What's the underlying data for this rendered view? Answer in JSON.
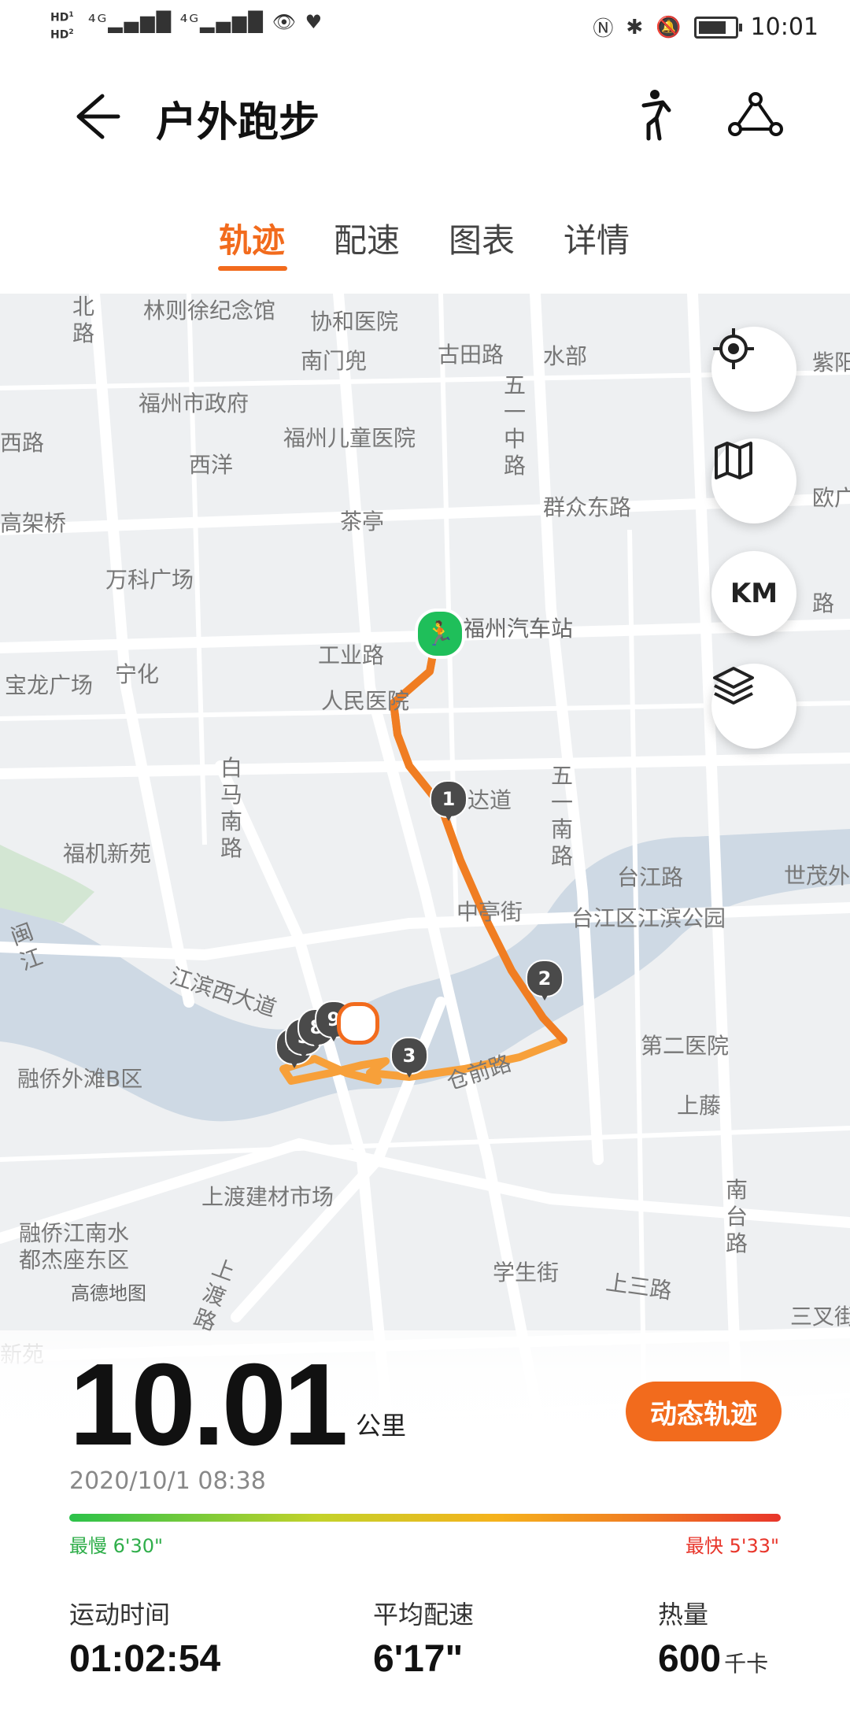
{
  "status_bar": {
    "left_indicators": "HD HD 4G 4G",
    "time": "10:01"
  },
  "header": {
    "title": "户外跑步",
    "back_icon": "arrow-left-icon",
    "runner_icon": "runner-pose-icon",
    "route_icon": "route-share-icon"
  },
  "tabs": [
    {
      "label": "轨迹",
      "active": true
    },
    {
      "label": "配速",
      "active": false
    },
    {
      "label": "图表",
      "active": false
    },
    {
      "label": "详情",
      "active": false
    }
  ],
  "map": {
    "labels": {
      "l1": "林则徐纪念馆",
      "l2": "协和医院",
      "l3": "南门兜",
      "l4": "古田路",
      "l5": "水部",
      "l6": "福州市政府",
      "l7": "福州儿童医院",
      "l8": "西洋",
      "l9": "群众东路",
      "l10": "茶亭",
      "l11": "万科广场",
      "l12": "福州汽车站",
      "l13": "工业路",
      "l14": "宁化",
      "l15": "宝龙广场",
      "l16": "人民医院",
      "l17": "福机新苑",
      "l18": "达道",
      "l19": "台江路",
      "l20": "世茂外",
      "l21": "中亭街",
      "l22": "台江区江滨公园",
      "l23": "江滨西大道",
      "l24": "第二医院",
      "l25": "融侨外滩B区",
      "l26": "上藤",
      "l27": "上渡建材市场",
      "l28": "融侨江南水",
      "l29": "都杰座东区",
      "l30": "学生街",
      "l31": "上三路",
      "l32": "高德地图",
      "l33": "三叉街",
      "l34": "紫阳",
      "l35": "西路",
      "l36": "高架桥",
      "l37": "欧广",
      "l38": "路",
      "l39": "新苑",
      "l40": "白马南路",
      "l41": "五一中路",
      "l42": "五一南路",
      "l43": "北路",
      "l44": "闽江",
      "l45": "南台路",
      "l46": "上渡路",
      "l47": "仓前路"
    },
    "km_markers": [
      "1",
      "2",
      "3",
      "9",
      "8",
      "5",
      "4"
    ],
    "control_icons": [
      "locate-icon",
      "map-icon",
      "km-toggle",
      "layers-icon"
    ],
    "km_button_label": "KM"
  },
  "summary": {
    "distance": "10.01",
    "distance_unit": "公里",
    "dynamic_track_button": "动态轨迹",
    "datetime": "2020/10/1 08:38",
    "slowest_label": "最慢 6'30\"",
    "fastest_label": "最快 5'33\"",
    "stats": [
      {
        "label": "运动时间",
        "value": "01:02:54",
        "unit": ""
      },
      {
        "label": "平均配速",
        "value": "6'17\"",
        "unit": ""
      },
      {
        "label": "热量",
        "value": "600",
        "unit": "千卡"
      }
    ]
  }
}
